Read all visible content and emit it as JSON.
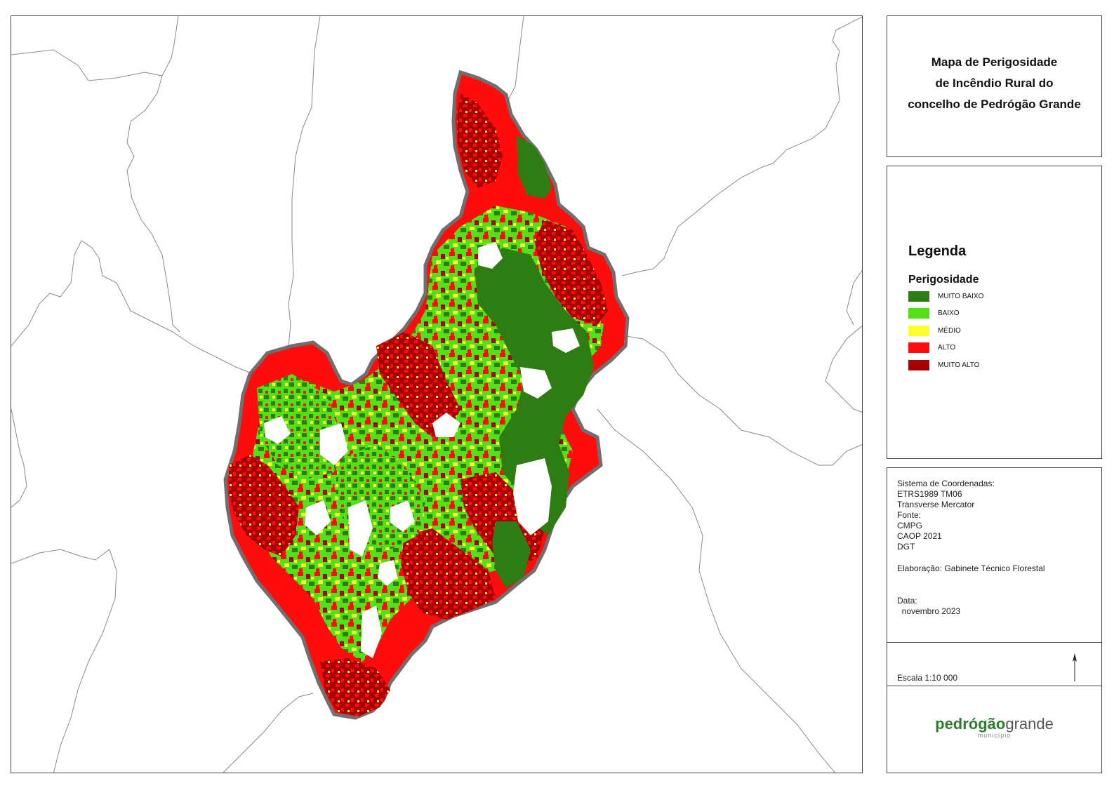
{
  "title": {
    "line1": "Mapa de Perigosidade",
    "line2": "de Incêndio Rural do",
    "line3": "concelho de Pedrógão Grande"
  },
  "legend": {
    "heading": "Legenda",
    "subheading": "Perigosidade",
    "items": [
      {
        "label": "MUITO BAIXO",
        "color": "#2e7d12"
      },
      {
        "label": "BAIXO",
        "color": "#52e017"
      },
      {
        "label": "MÉDIO",
        "color": "#ffff2e"
      },
      {
        "label": "ALTO",
        "color": "#ff0d0d"
      },
      {
        "label": "MUITO ALTO",
        "color": "#a80000"
      }
    ]
  },
  "info": {
    "lines": [
      "Sistema de Coordenadas:",
      "ETRS1989 TM06",
      "Transverse Mercator",
      "Fonte:",
      "CMPG",
      "CAOP 2021",
      "DGT",
      "Elaboração: Gabinete Técnico Florestal",
      "Data:",
      "  novembro 2023"
    ],
    "scale": "Escala  1:10 000"
  },
  "logo": {
    "word1": "pedrógão",
    "word2": "grande",
    "sub": "município"
  },
  "colors": {
    "muito_baixo": "#2e7d12",
    "baixo": "#52e017",
    "medio": "#ffff2e",
    "alto": "#ff0d0d",
    "muito_alto": "#a80000",
    "boundary": "#8a8a8a"
  }
}
